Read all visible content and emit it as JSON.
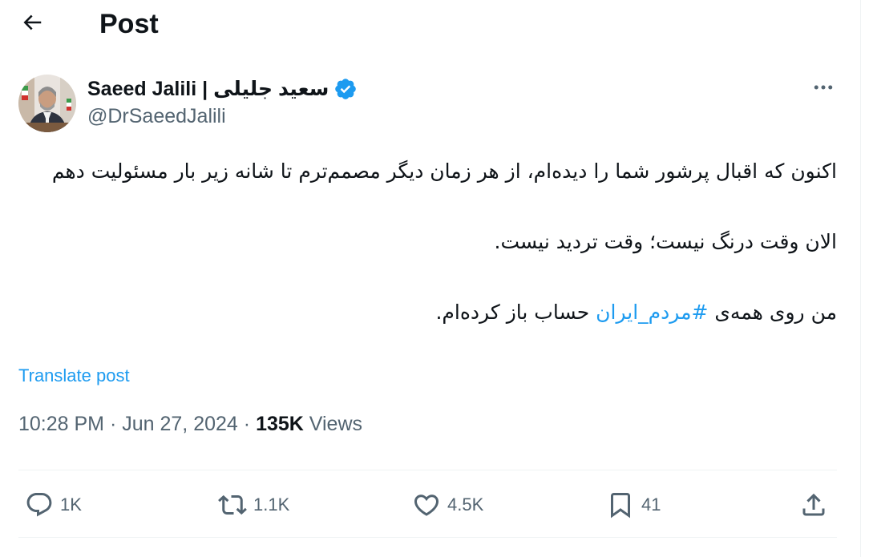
{
  "header": {
    "title": "Post"
  },
  "author": {
    "name": "Saeed Jalili | سعید جلیلی",
    "handle": "@DrSaeedJalili",
    "verified": true
  },
  "tweet": {
    "paragraphs": [
      "اکنون که اقبال پرشور شما را دیده‌ام، از هر زمان دیگر مصمم‌ترم تا شانه زیر بار مسئولیت دهم",
      "الان وقت درنگ نیست؛ وقت تردید نیست."
    ],
    "last_line_prefix": "من روی همه‌ی ",
    "hashtag": "#مردم_ایران",
    "last_line_suffix": " حساب باز کرده‌ام.",
    "translate_label": "Translate post",
    "time": "10:28 PM",
    "date": "Jun 27, 2024",
    "separator": "·",
    "views_count": "135K",
    "views_label": "Views"
  },
  "actions": {
    "replies": "1K",
    "reposts": "1.1K",
    "likes": "4.5K",
    "bookmarks": "41"
  },
  "colors": {
    "accent": "#1d9bf0",
    "text": "#0f1419",
    "secondary_text": "#536471",
    "divider": "#eff3f4"
  }
}
